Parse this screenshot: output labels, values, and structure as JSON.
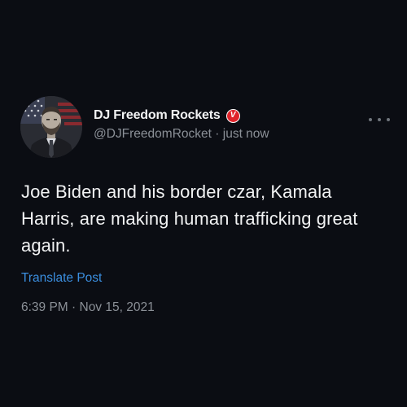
{
  "post": {
    "author": {
      "display_name": "DJ Freedom Rockets",
      "badge_letter": "V",
      "handle": "@DJFreedomRocket",
      "relative_time": "just now",
      "separator": "·"
    },
    "body": "Joe Biden and his border czar, Kamala Harris, are making human trafficking great again.",
    "translate_label": "Translate Post",
    "timestamp": "6:39 PM · Nov 15, 2021"
  },
  "icons": {
    "more": "more-options-icon",
    "badge": "verified-badge-icon"
  },
  "colors": {
    "background": "#0b0d13",
    "text_primary": "#f1f2f3",
    "text_secondary": "#8b9097",
    "link": "#3b8fe0",
    "badge": "#e0232a"
  }
}
